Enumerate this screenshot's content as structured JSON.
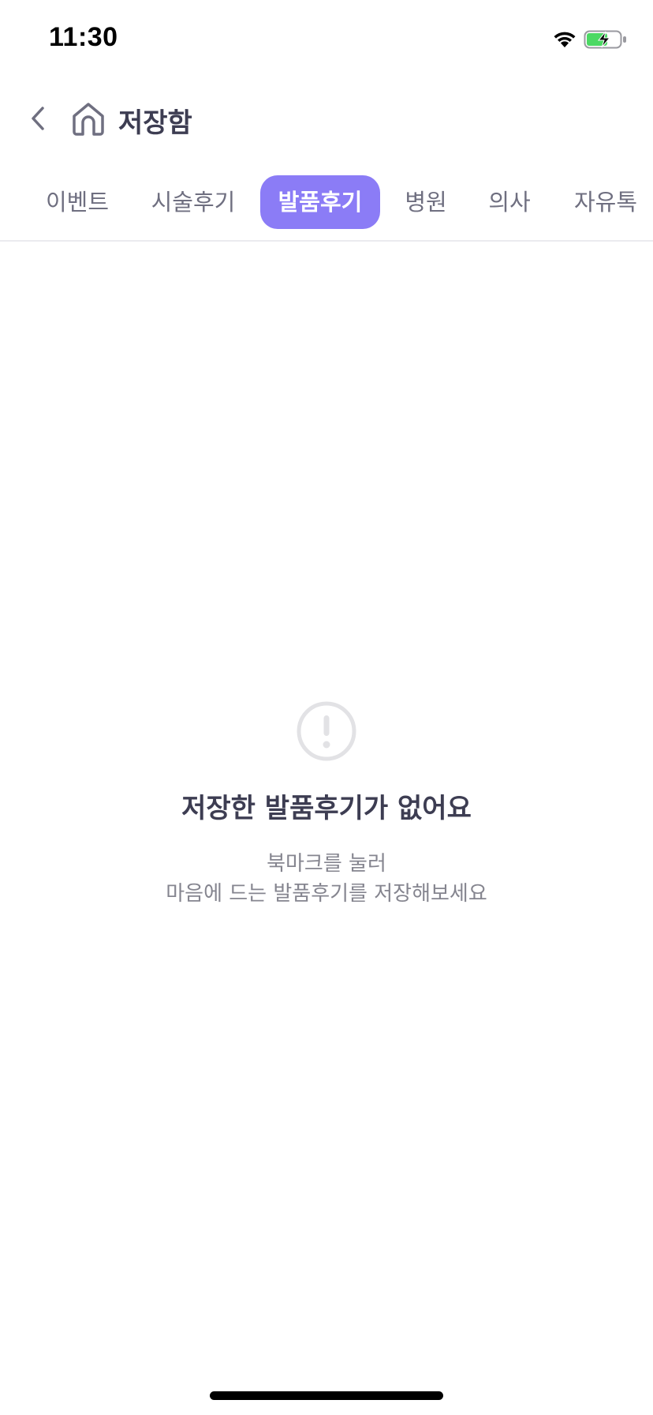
{
  "status_bar": {
    "time": "11:30"
  },
  "nav": {
    "title": "저장함",
    "back_icon": "chevron-left-icon",
    "home_icon": "home-icon"
  },
  "tabs": [
    {
      "label": "이벤트",
      "active": false
    },
    {
      "label": "시술후기",
      "active": false
    },
    {
      "label": "발품후기",
      "active": true
    },
    {
      "label": "병원",
      "active": false
    },
    {
      "label": "의사",
      "active": false
    },
    {
      "label": "자유톡",
      "active": false
    }
  ],
  "empty_state": {
    "icon": "alert-circle-icon",
    "title": "저장한 발품후기가 없어요",
    "desc_line1": "북마크를 눌러",
    "desc_line2": "마음에 드는 발품후기를 저장해보세요"
  },
  "colors": {
    "accent": "#8b7cf6",
    "title": "#3d3d52",
    "muted": "#85858f",
    "battery": "#4cd964"
  }
}
